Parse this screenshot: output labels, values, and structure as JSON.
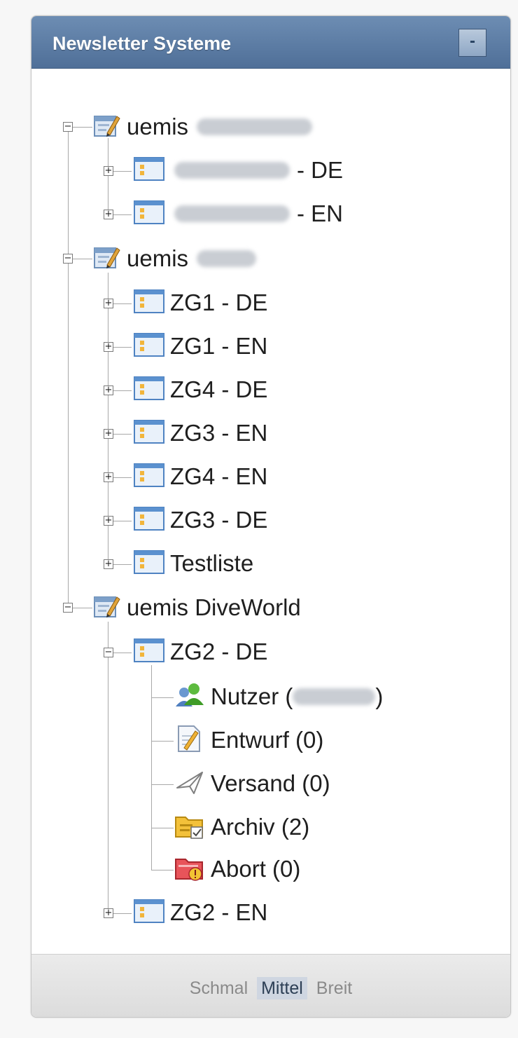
{
  "panel": {
    "title": "Newsletter Systeme",
    "collapse_label": "-"
  },
  "tree": {
    "group1": {
      "label": "uemis",
      "lists": [
        {
          "label": "- DE"
        },
        {
          "label": "- EN"
        }
      ]
    },
    "group2": {
      "label": "uemis",
      "lists": [
        {
          "label": "ZG1 - DE"
        },
        {
          "label": "ZG1 - EN"
        },
        {
          "label": "ZG4 - DE"
        },
        {
          "label": "ZG3 - EN"
        },
        {
          "label": "ZG4 - EN"
        },
        {
          "label": "ZG3 - DE"
        },
        {
          "label": "Testliste"
        }
      ]
    },
    "group3": {
      "label": "uemis DiveWorld",
      "expanded_list": {
        "label": "ZG2 - DE",
        "children": {
          "nutzer_prefix": "Nutzer (",
          "nutzer_suffix": ")",
          "entwurf": "Entwurf (0)",
          "versand": "Versand (0)",
          "archiv": "Archiv (2)",
          "abort": "Abort (0)"
        }
      },
      "collapsed_list": {
        "label": "ZG2 - EN"
      }
    },
    "toggle_collapsed": "+",
    "toggle_expanded": "−"
  },
  "footer": {
    "options": [
      "Schmal",
      "Mittel",
      "Breit"
    ],
    "selected": "Mittel"
  },
  "icons": {
    "group": "edit-folder-icon",
    "list": "list-window-icon",
    "users": "users-icon",
    "draft": "draft-document-icon",
    "sent": "paper-plane-icon",
    "archive": "archive-folder-icon",
    "abort": "abort-folder-icon"
  }
}
